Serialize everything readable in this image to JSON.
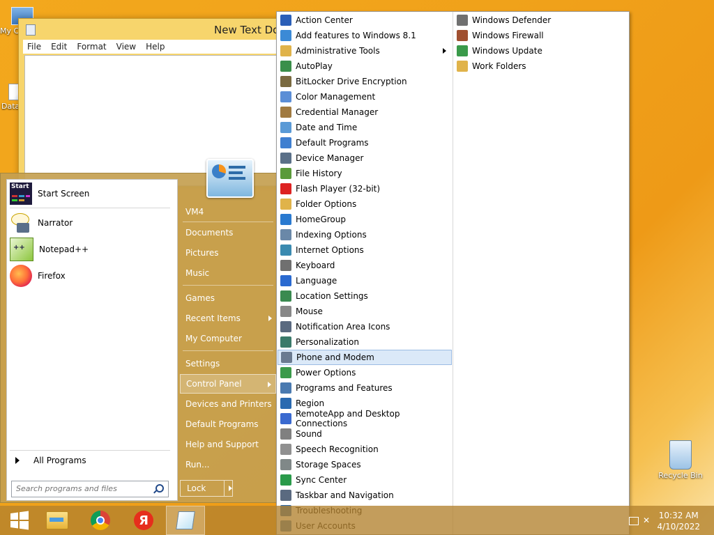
{
  "desktop": {
    "icons": [
      {
        "label": "My C",
        "icon": "my-computer-icon"
      },
      {
        "label": "Data",
        "icon": "data-icon"
      }
    ],
    "recycle_bin": {
      "label": "Recycle Bin",
      "icon": "recycle-bin-icon"
    }
  },
  "notepad": {
    "title": "New Text Doc",
    "menu": [
      "File",
      "Edit",
      "Format",
      "View",
      "Help"
    ]
  },
  "start_menu": {
    "programs": [
      {
        "label": "Start Screen",
        "icon": "start-screen-icon"
      },
      {
        "label": "Narrator",
        "icon": "narrator-icon"
      },
      {
        "label": "Notepad++",
        "icon": "notepad-plus-plus-icon"
      },
      {
        "label": "Firefox",
        "icon": "firefox-icon"
      }
    ],
    "all_programs": "All Programs",
    "search_placeholder": "Search programs and files",
    "right_items": [
      {
        "label": "VM4",
        "submenu": false
      },
      {
        "label": "Documents",
        "submenu": false
      },
      {
        "label": "Pictures",
        "submenu": false
      },
      {
        "label": "Music",
        "submenu": false
      },
      {
        "label": "Games",
        "submenu": false
      },
      {
        "label": "Recent Items",
        "submenu": true
      },
      {
        "label": "My Computer",
        "submenu": false
      },
      {
        "label": "Settings",
        "submenu": false
      },
      {
        "label": "Control Panel",
        "submenu": true,
        "selected": true
      },
      {
        "label": "Devices and Printers",
        "submenu": false
      },
      {
        "label": "Default Programs",
        "submenu": false
      },
      {
        "label": "Help and Support",
        "submenu": false
      },
      {
        "label": "Run...",
        "submenu": false
      }
    ],
    "lock_label": "Lock"
  },
  "control_panel": {
    "left_column": [
      {
        "label": "Action Center",
        "icon": "flag-icon"
      },
      {
        "label": "Add features to Windows 8.1",
        "icon": "add-features-icon"
      },
      {
        "label": "Administrative Tools",
        "icon": "folder-icon",
        "submenu": true
      },
      {
        "label": "AutoPlay",
        "icon": "autoplay-icon"
      },
      {
        "label": "BitLocker Drive Encryption",
        "icon": "bitlocker-icon"
      },
      {
        "label": "Color Management",
        "icon": "color-management-icon"
      },
      {
        "label": "Credential Manager",
        "icon": "credential-manager-icon"
      },
      {
        "label": "Date and Time",
        "icon": "clock-icon"
      },
      {
        "label": "Default Programs",
        "icon": "default-programs-icon"
      },
      {
        "label": "Device Manager",
        "icon": "device-manager-icon"
      },
      {
        "label": "File History",
        "icon": "file-history-icon"
      },
      {
        "label": "Flash Player (32-bit)",
        "icon": "flash-icon"
      },
      {
        "label": "Folder Options",
        "icon": "folder-options-icon"
      },
      {
        "label": "HomeGroup",
        "icon": "homegroup-icon"
      },
      {
        "label": "Indexing Options",
        "icon": "indexing-icon"
      },
      {
        "label": "Internet Options",
        "icon": "internet-options-icon"
      },
      {
        "label": "Keyboard",
        "icon": "keyboard-icon"
      },
      {
        "label": "Language",
        "icon": "language-icon"
      },
      {
        "label": "Location Settings",
        "icon": "location-icon"
      },
      {
        "label": "Mouse",
        "icon": "mouse-icon"
      },
      {
        "label": "Notification Area Icons",
        "icon": "notification-icon"
      },
      {
        "label": "Personalization",
        "icon": "personalization-icon"
      },
      {
        "label": "Phone and Modem",
        "icon": "phone-modem-icon",
        "selected": true
      },
      {
        "label": "Power Options",
        "icon": "power-icon"
      },
      {
        "label": "Programs and Features",
        "icon": "programs-features-icon"
      },
      {
        "label": "Region",
        "icon": "region-icon"
      },
      {
        "label": "RemoteApp and Desktop Connections",
        "icon": "remoteapp-icon"
      },
      {
        "label": "Sound",
        "icon": "sound-icon"
      },
      {
        "label": "Speech Recognition",
        "icon": "microphone-icon"
      },
      {
        "label": "Storage Spaces",
        "icon": "storage-icon"
      },
      {
        "label": "Sync Center",
        "icon": "sync-icon"
      },
      {
        "label": "Taskbar and Navigation",
        "icon": "taskbar-icon"
      },
      {
        "label": "Troubleshooting",
        "icon": "troubleshooting-icon"
      },
      {
        "label": "User Accounts",
        "icon": "user-accounts-icon"
      }
    ],
    "right_column": [
      {
        "label": "Windows Defender",
        "icon": "defender-icon"
      },
      {
        "label": "Windows Firewall",
        "icon": "firewall-icon"
      },
      {
        "label": "Windows Update",
        "icon": "update-icon"
      },
      {
        "label": "Work Folders",
        "icon": "work-folders-icon"
      }
    ]
  },
  "taskbar": {
    "buttons": [
      {
        "name": "start-button",
        "icon": "windows-logo-icon"
      },
      {
        "name": "file-explorer-button",
        "icon": "file-explorer-icon"
      },
      {
        "name": "chrome-button",
        "icon": "chrome-icon"
      },
      {
        "name": "yandex-button",
        "icon": "yandex-icon"
      },
      {
        "name": "notepad-button",
        "icon": "notepad-icon",
        "active": true
      }
    ],
    "time": "10:32 AM",
    "date": "4/10/2022"
  },
  "colors": {
    "accent_start": "#c4a050",
    "selection": "#dbe9f8",
    "desktop_orange": "#f0a11a"
  }
}
